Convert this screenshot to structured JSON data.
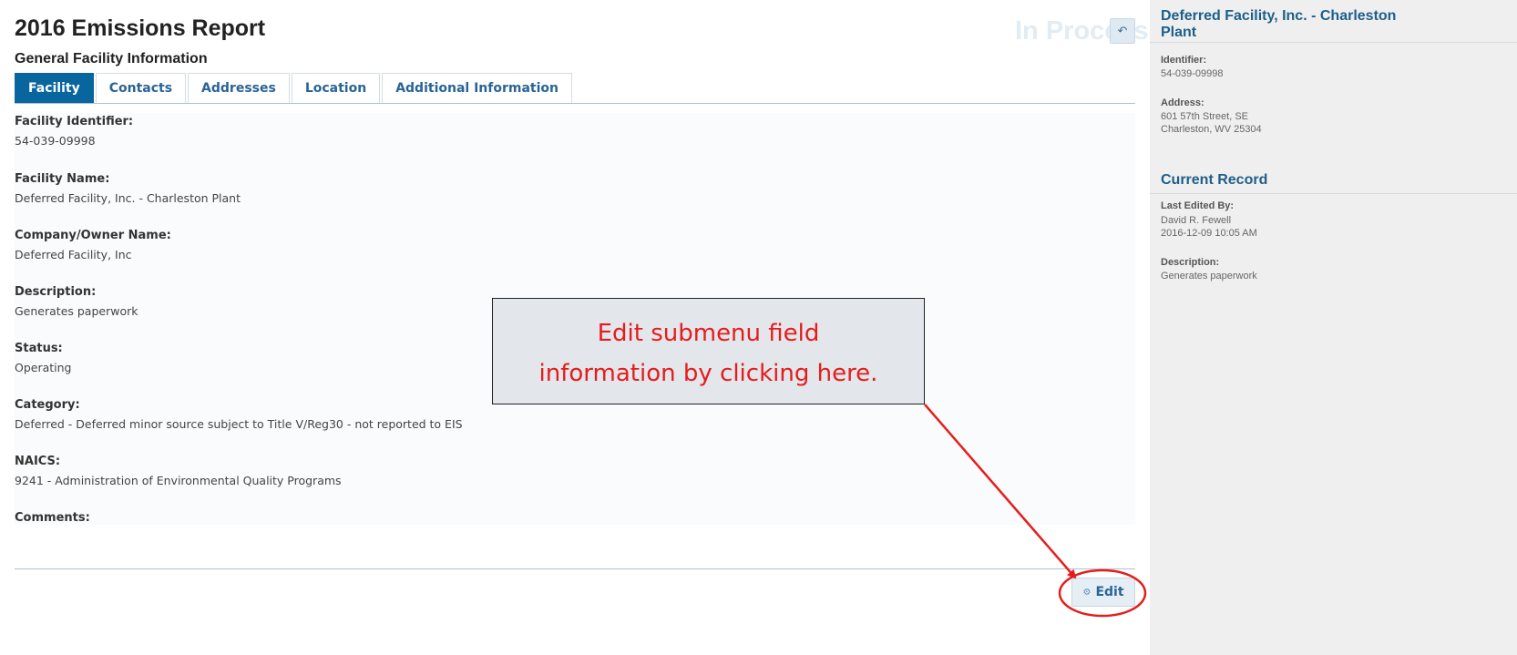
{
  "header": {
    "title": "2016 Emissions Report",
    "section": "General Facility Information",
    "status": "In Process",
    "back_icon": "reply-icon"
  },
  "tabs": [
    {
      "label": "Facility",
      "active": true
    },
    {
      "label": "Contacts",
      "active": false
    },
    {
      "label": "Addresses",
      "active": false
    },
    {
      "label": "Location",
      "active": false
    },
    {
      "label": "Additional Information",
      "active": false
    }
  ],
  "fields": [
    {
      "label": "Facility Identifier:",
      "value": "54-039-09998"
    },
    {
      "label": "Facility Name:",
      "value": "Deferred Facility, Inc. - Charleston Plant"
    },
    {
      "label": "Company/Owner Name:",
      "value": "Deferred Facility, Inc"
    },
    {
      "label": "Description:",
      "value": "Generates paperwork"
    },
    {
      "label": "Status:",
      "value": "Operating"
    },
    {
      "label": "Category:",
      "value": "Deferred - Deferred minor source subject to Title V/Reg30 - not reported to EIS"
    },
    {
      "label": "NAICS:",
      "value": "9241 - Administration of Environmental Quality Programs"
    },
    {
      "label": "Comments:",
      "value": ""
    }
  ],
  "edit_button": {
    "label": "Edit",
    "icon": "gear-icon"
  },
  "sidebar": {
    "facility_title": "Deferred Facility, Inc. - Charleston Plant",
    "identifier_label": "Identifier:",
    "identifier_value": "54-039-09998",
    "address_label": "Address:",
    "address_line1": "601 57th Street, SE",
    "address_line2": "Charleston, WV 25304",
    "current_record_title": "Current Record",
    "last_edited_label": "Last Edited By:",
    "last_edited_name": "David R. Fewell",
    "last_edited_time": "2016-12-09 10:05 AM",
    "description_label": "Description:",
    "description_value": "Generates paperwork"
  },
  "annotation": {
    "line1": "Edit submenu field",
    "line2": "information by clicking here.",
    "color": "#e61c1c"
  }
}
